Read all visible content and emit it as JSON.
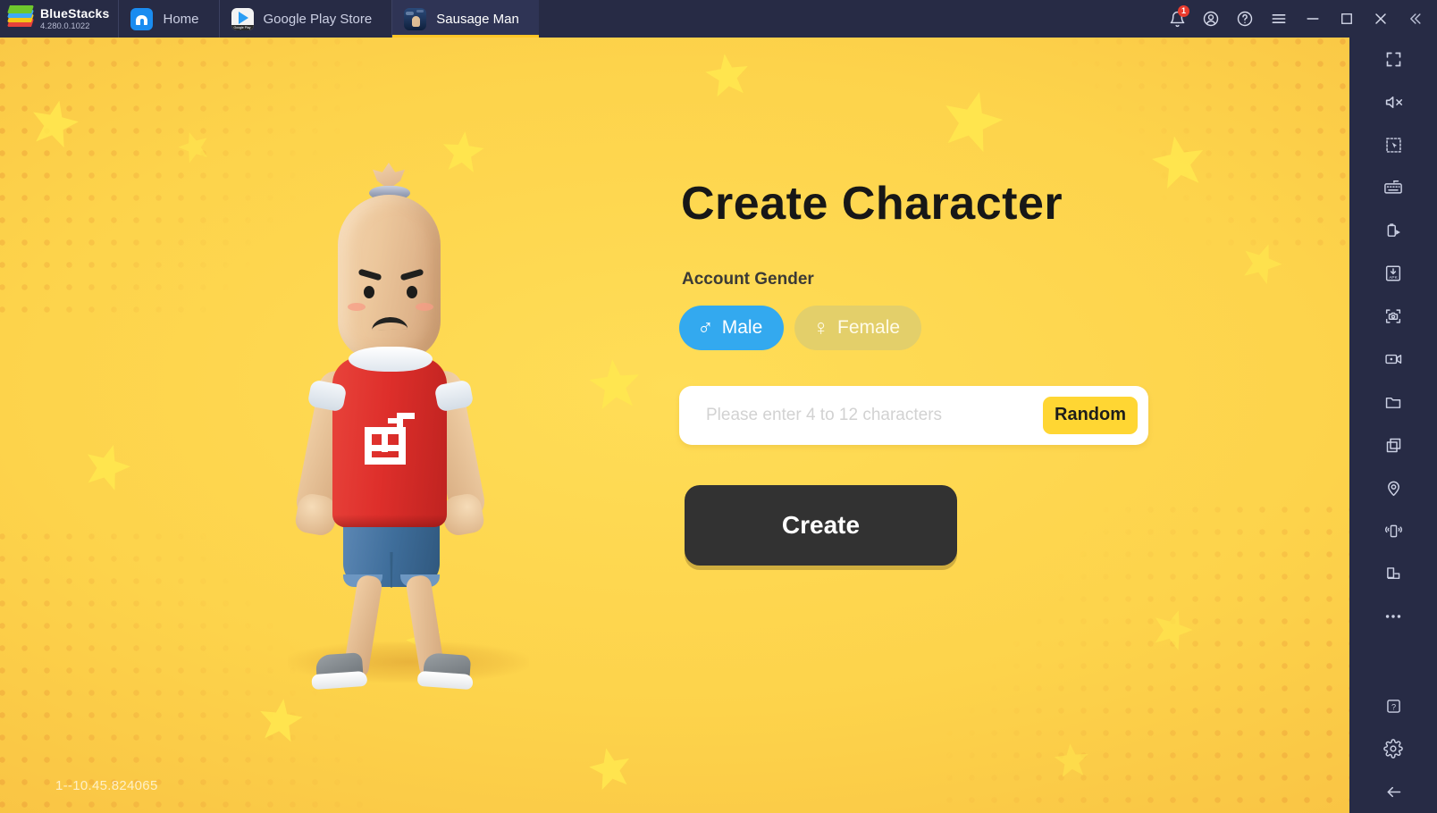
{
  "app": {
    "brand": "BlueStacks",
    "version": "4.280.0.1022"
  },
  "titlebar": {
    "tabs": [
      {
        "label": "Home",
        "icon": "home-icon",
        "active": false
      },
      {
        "label": "Google Play Store",
        "icon": "google-play-icon",
        "active": false
      },
      {
        "label": "Sausage Man",
        "icon": "sausage-man-icon",
        "active": true
      }
    ],
    "play_badge_text": "Google Play",
    "actions": [
      {
        "name": "notifications-icon",
        "badge": "1"
      },
      {
        "name": "account-icon",
        "badge": ""
      },
      {
        "name": "help-icon",
        "badge": ""
      },
      {
        "name": "menu-icon",
        "badge": ""
      },
      {
        "name": "minimize-icon",
        "badge": ""
      },
      {
        "name": "maximize-icon",
        "badge": ""
      },
      {
        "name": "close-icon",
        "badge": ""
      },
      {
        "name": "collapse-icon",
        "badge": ""
      }
    ]
  },
  "game": {
    "title": "Create Character",
    "gender_label": "Account Gender",
    "gender_options": [
      {
        "label": "Male",
        "glyph": "♂",
        "selected": true
      },
      {
        "label": "Female",
        "glyph": "♀",
        "selected": false
      }
    ],
    "name_placeholder": "Please enter 4 to 12 characters",
    "name_value": "",
    "random_label": "Random",
    "create_label": "Create",
    "version_text": "1--10.45.824065",
    "colors": {
      "background_yellow": "#fdd34b",
      "male_blue": "#33a9ef",
      "female_tan": "#e3cf6a",
      "random_yellow": "#ffd633",
      "create_dark": "#323232",
      "shirt_red": "#de2f2b",
      "shorts_blue": "#3f6e9b"
    }
  },
  "sidebar": {
    "items": [
      {
        "name": "fullscreen-icon"
      },
      {
        "name": "mute-icon"
      },
      {
        "name": "keymapping-icon"
      },
      {
        "name": "keyboard-controls-icon"
      },
      {
        "name": "macro-recorder-icon"
      },
      {
        "name": "install-apk-icon"
      },
      {
        "name": "screenshot-icon"
      },
      {
        "name": "record-screen-icon"
      },
      {
        "name": "media-folder-icon"
      },
      {
        "name": "multi-instance-icon"
      },
      {
        "name": "location-icon"
      },
      {
        "name": "shake-icon"
      },
      {
        "name": "rotate-icon"
      },
      {
        "name": "more-icon"
      },
      {
        "name": "help-question-icon"
      },
      {
        "name": "settings-gear-icon"
      },
      {
        "name": "back-arrow-icon"
      }
    ]
  }
}
